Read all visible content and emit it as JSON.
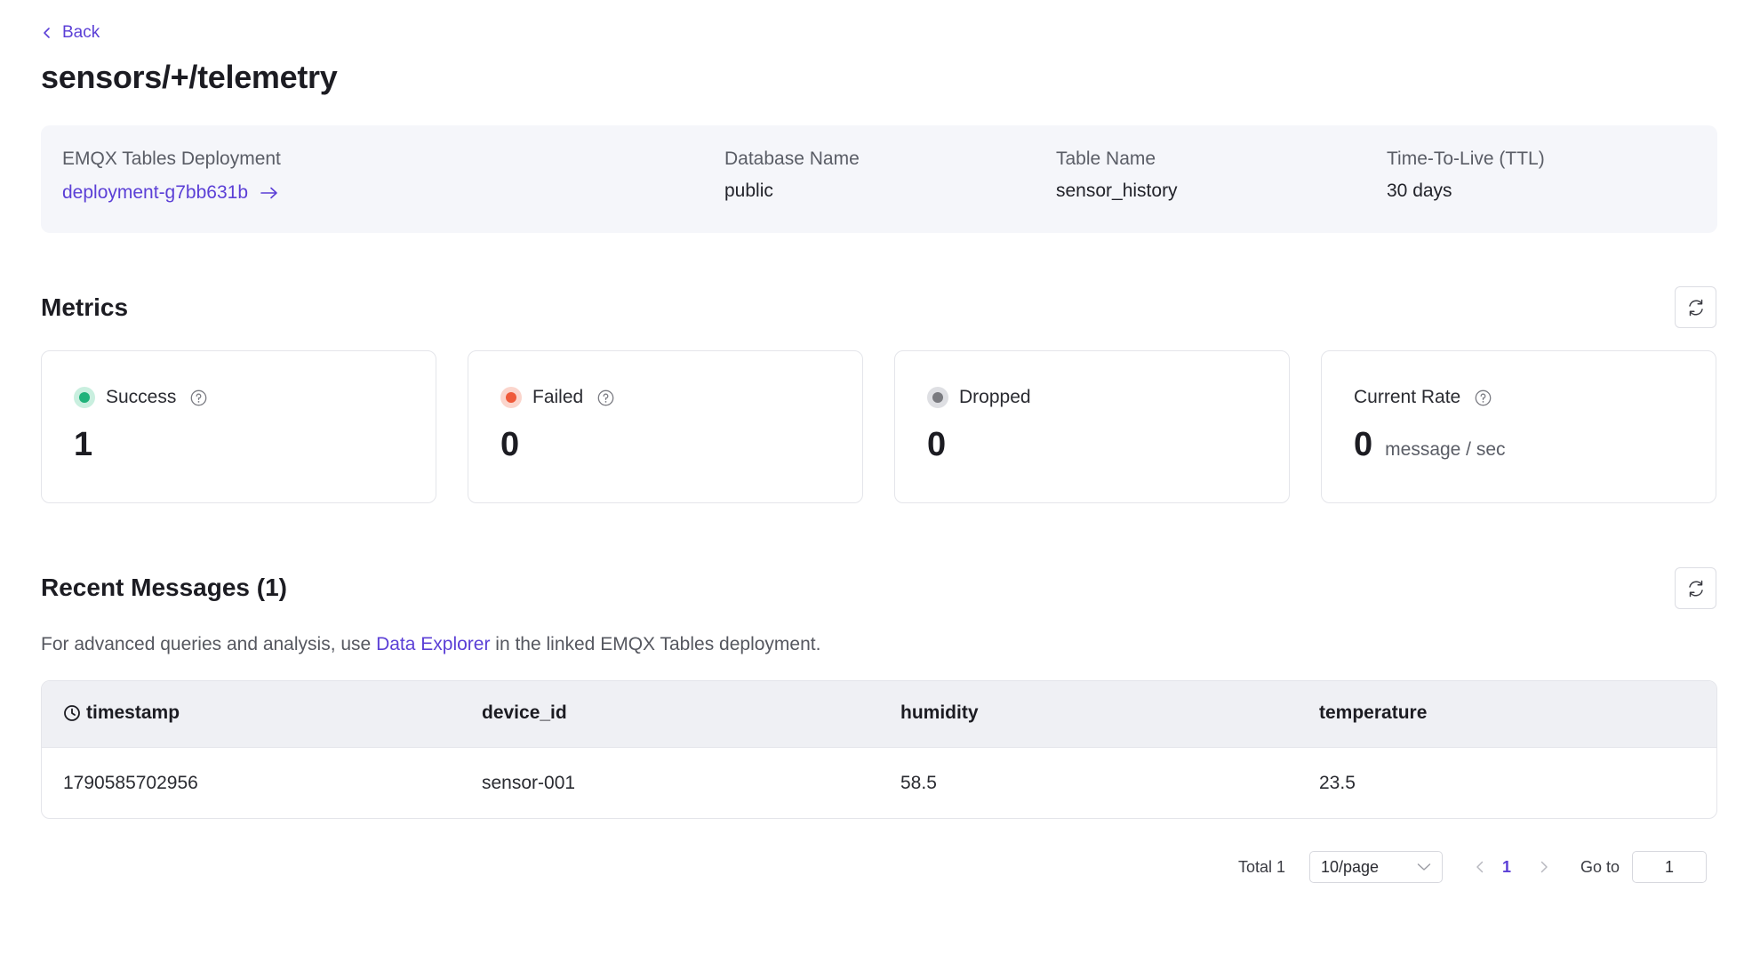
{
  "nav": {
    "back_label": "Back"
  },
  "page": {
    "title": "sensors/+/telemetry"
  },
  "info": {
    "deployment": {
      "label": "EMQX Tables Deployment",
      "value": "deployment-g7bb631b"
    },
    "database": {
      "label": "Database Name",
      "value": "public"
    },
    "table": {
      "label": "Table Name",
      "value": "sensor_history"
    },
    "ttl": {
      "label": "Time-To-Live (TTL)",
      "value": "30 days"
    }
  },
  "metrics": {
    "title": "Metrics",
    "success": {
      "label": "Success",
      "value": "1",
      "color": "#1fb27a"
    },
    "failed": {
      "label": "Failed",
      "value": "0",
      "color": "#ef5a3a"
    },
    "dropped": {
      "label": "Dropped",
      "value": "0",
      "color": "#7a7b80"
    },
    "rate": {
      "label": "Current Rate",
      "value": "0",
      "unit": "message / sec"
    }
  },
  "recent": {
    "title": "Recent Messages (1)",
    "helper_prefix": "For advanced queries and analysis, use ",
    "helper_link": "Data Explorer",
    "helper_suffix": " in the linked EMQX Tables deployment.",
    "columns": [
      "timestamp",
      "device_id",
      "humidity",
      "temperature"
    ],
    "rows": [
      [
        "1790585702956",
        "sensor-001",
        "58.5",
        "23.5"
      ]
    ]
  },
  "pagination": {
    "total": "Total 1",
    "page_size": "10/page",
    "current_page": "1",
    "goto_label": "Go to",
    "goto_value": "1"
  },
  "colors": {
    "accent": "#5b3fd6"
  }
}
